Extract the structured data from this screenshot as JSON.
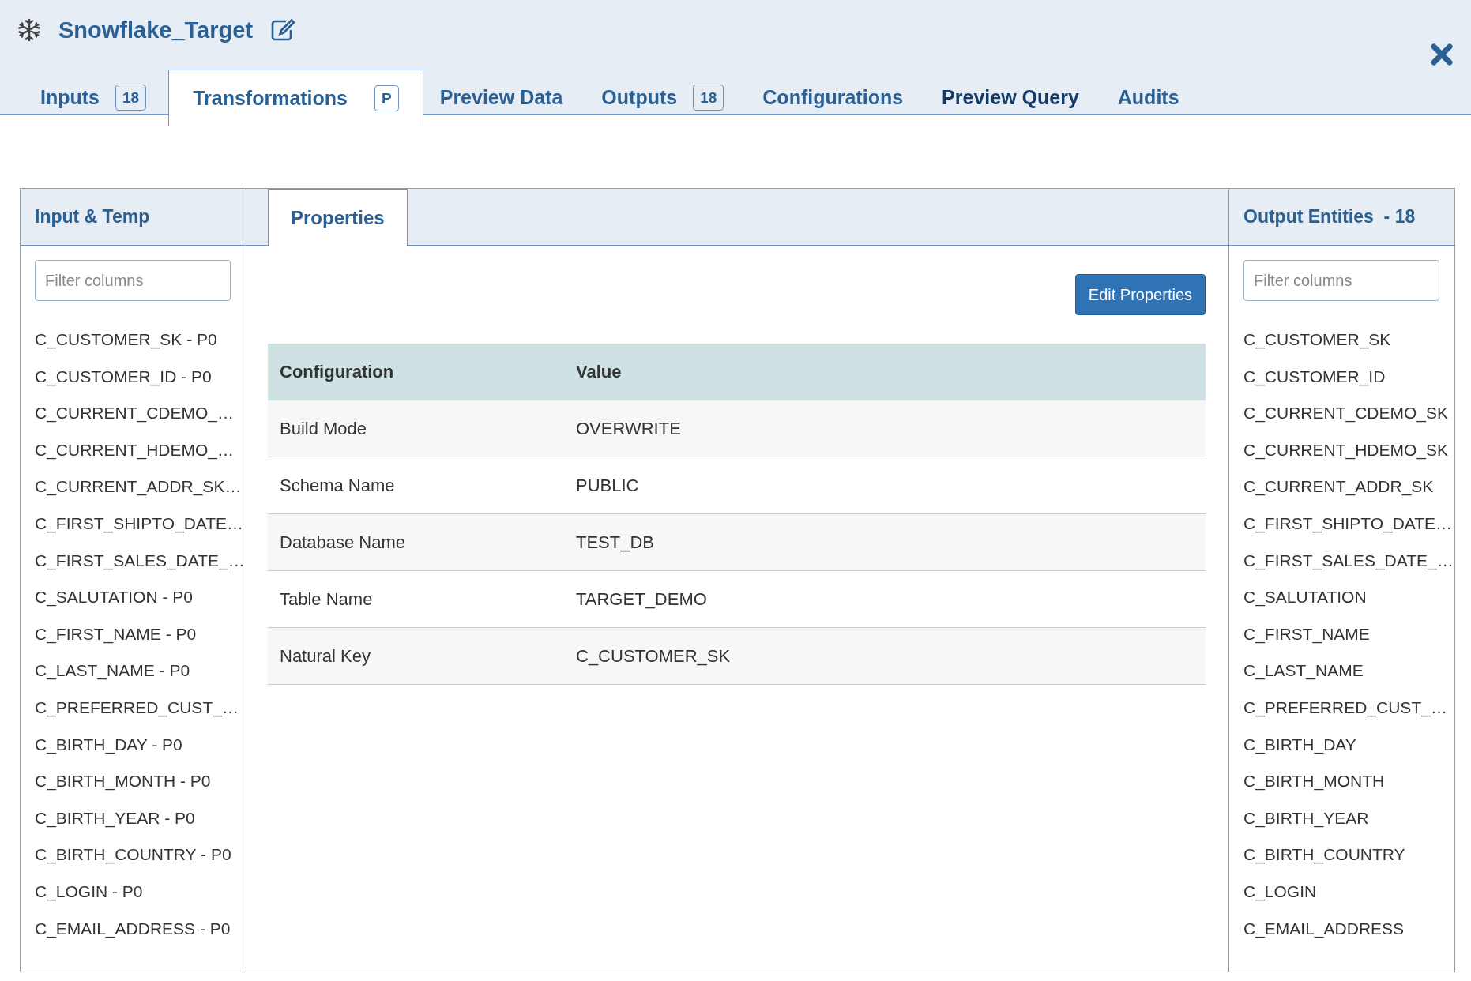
{
  "window": {
    "title": "Snowflake_Target"
  },
  "tabs": [
    {
      "label": "Inputs",
      "badge": "18",
      "selected": false,
      "highlighted": false
    },
    {
      "label": "Transformations",
      "badge": "P",
      "selected": true,
      "highlighted": false
    },
    {
      "label": "Preview Data",
      "selected": false,
      "highlighted": false
    },
    {
      "label": "Outputs",
      "badge": "18",
      "selected": false,
      "highlighted": false
    },
    {
      "label": "Configurations",
      "selected": false,
      "highlighted": false
    },
    {
      "label": "Preview Query",
      "selected": false,
      "highlighted": true
    },
    {
      "label": "Audits",
      "selected": false,
      "highlighted": false
    }
  ],
  "input_panel": {
    "title": "Input & Temp",
    "filter": {
      "placeholder": "Filter columns"
    },
    "items": [
      "C_CUSTOMER_SK - P0",
      "C_CUSTOMER_ID - P0",
      "C_CURRENT_CDEMO_…",
      "C_CURRENT_HDEMO_…",
      "C_CURRENT_ADDR_SK…",
      "C_FIRST_SHIPTO_DATE…",
      "C_FIRST_SALES_DATE_…",
      "C_SALUTATION - P0",
      "C_FIRST_NAME - P0",
      "C_LAST_NAME - P0",
      "C_PREFERRED_CUST_…",
      "C_BIRTH_DAY - P0",
      "C_BIRTH_MONTH - P0",
      "C_BIRTH_YEAR - P0",
      "C_BIRTH_COUNTRY - P0",
      "C_LOGIN - P0",
      "C_EMAIL_ADDRESS - P0"
    ]
  },
  "center_panel": {
    "tabs": [
      {
        "label": "Properties",
        "selected": true
      }
    ],
    "edit_button": "Edit Properties",
    "table": {
      "columns": [
        "Configuration",
        "Value"
      ],
      "rows": [
        [
          "Build Mode",
          "OVERWRITE"
        ],
        [
          "Schema Name",
          "PUBLIC"
        ],
        [
          "Database Name",
          "TEST_DB"
        ],
        [
          "Table Name",
          "TARGET_DEMO"
        ],
        [
          "Natural Key",
          "C_CUSTOMER_SK"
        ]
      ]
    }
  },
  "output_panel": {
    "title": "Output Entities  - 18",
    "filter": {
      "placeholder": "Filter columns"
    },
    "items": [
      "C_CUSTOMER_SK",
      "C_CUSTOMER_ID",
      "C_CURRENT_CDEMO_SK",
      "C_CURRENT_HDEMO_SK",
      "C_CURRENT_ADDR_SK",
      "C_FIRST_SHIPTO_DATE…",
      "C_FIRST_SALES_DATE_…",
      "C_SALUTATION",
      "C_FIRST_NAME",
      "C_LAST_NAME",
      "C_PREFERRED_CUST_…",
      "C_BIRTH_DAY",
      "C_BIRTH_MONTH",
      "C_BIRTH_YEAR",
      "C_BIRTH_COUNTRY",
      "C_LOGIN",
      "C_EMAIL_ADDRESS"
    ]
  }
}
